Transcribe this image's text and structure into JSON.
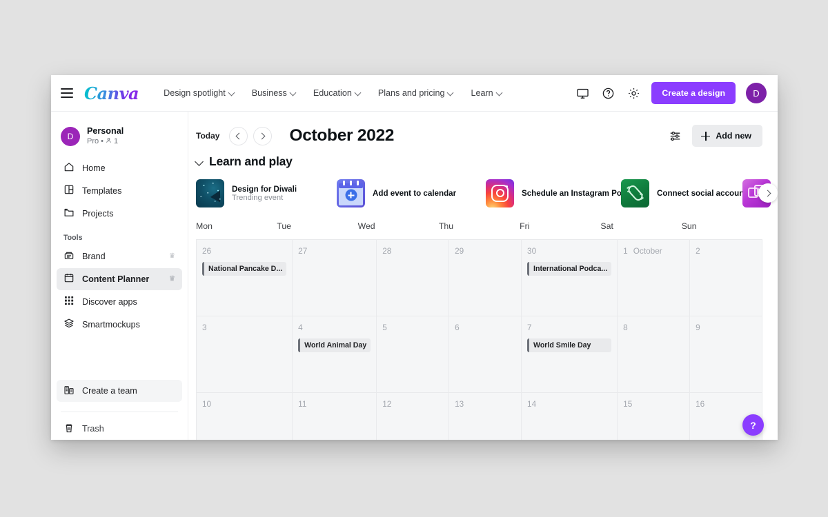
{
  "header": {
    "menu_icon": "hamburger-icon",
    "logo_text": "Canva",
    "nav": [
      {
        "label": "Design spotlight"
      },
      {
        "label": "Business"
      },
      {
        "label": "Education"
      },
      {
        "label": "Plans and pricing"
      },
      {
        "label": "Learn"
      }
    ],
    "icons": [
      {
        "name": "monitor-icon"
      },
      {
        "name": "help-circle-icon"
      },
      {
        "name": "gear-icon"
      }
    ],
    "cta_label": "Create a design",
    "avatar_initial": "D"
  },
  "sidebar": {
    "account": {
      "avatar_initial": "D",
      "name": "Personal",
      "plan": "Pro",
      "separator": "•",
      "members": "1"
    },
    "items": [
      {
        "label": "Home",
        "icon": "home-icon",
        "pro": false,
        "active": false
      },
      {
        "label": "Templates",
        "icon": "templates-icon",
        "pro": false,
        "active": false
      },
      {
        "label": "Projects",
        "icon": "folder-icon",
        "pro": false,
        "active": false
      }
    ],
    "tools_label": "Tools",
    "tools": [
      {
        "label": "Brand",
        "icon": "brand-icon",
        "pro": true,
        "active": false
      },
      {
        "label": "Content Planner",
        "icon": "calendar-icon",
        "pro": true,
        "active": true
      },
      {
        "label": "Discover apps",
        "icon": "apps-grid-icon",
        "pro": false,
        "active": false
      },
      {
        "label": "Smartmockups",
        "icon": "stack-icon",
        "pro": false,
        "active": false
      }
    ],
    "bottom": [
      {
        "label": "Create a team",
        "icon": "team-icon",
        "highlight": true
      },
      {
        "label": "Trash",
        "icon": "trash-icon",
        "highlight": false
      }
    ],
    "crown_glyph": "♛"
  },
  "toolbar": {
    "today_label": "Today",
    "prev_icon": "chevron-left-icon",
    "next_icon": "chevron-right-icon",
    "month_title": "October 2022",
    "filter_icon": "sliders-icon",
    "add_new_label": "Add new"
  },
  "section": {
    "collapse_icon": "chevron-down-icon",
    "title": "Learn and play",
    "cards": [
      {
        "title": "Design for Diwali",
        "subtitle": "Trending event",
        "thumb": "diwali-sparkler-thumb"
      },
      {
        "title": "Add event to calendar",
        "subtitle": "",
        "thumb": "calendar-plus-thumb"
      },
      {
        "title": "Schedule an Instagram Post",
        "subtitle": "",
        "thumb": "instagram-thumb"
      },
      {
        "title": "Connect social accounts",
        "subtitle": "",
        "thumb": "link-thumb"
      },
      {
        "title": "",
        "subtitle": "",
        "thumb": "video-thumb"
      }
    ],
    "next_icon": "chevron-right-icon"
  },
  "calendar": {
    "weekdays": [
      "Mon",
      "Tue",
      "Wed",
      "Thu",
      "Fri",
      "Sat",
      "Sun"
    ],
    "cells": [
      {
        "day": "26",
        "month_label": "",
        "events": [
          {
            "title": "National Pancake D..."
          }
        ]
      },
      {
        "day": "27",
        "month_label": "",
        "events": []
      },
      {
        "day": "28",
        "month_label": "",
        "events": []
      },
      {
        "day": "29",
        "month_label": "",
        "events": []
      },
      {
        "day": "30",
        "month_label": "",
        "events": [
          {
            "title": "International Podca..."
          }
        ]
      },
      {
        "day": "1",
        "month_label": "October",
        "events": []
      },
      {
        "day": "2",
        "month_label": "",
        "events": []
      },
      {
        "day": "3",
        "month_label": "",
        "events": []
      },
      {
        "day": "4",
        "month_label": "",
        "events": [
          {
            "title": "World Animal Day"
          }
        ]
      },
      {
        "day": "5",
        "month_label": "",
        "events": []
      },
      {
        "day": "6",
        "month_label": "",
        "events": []
      },
      {
        "day": "7",
        "month_label": "",
        "events": [
          {
            "title": "World Smile Day"
          }
        ]
      },
      {
        "day": "8",
        "month_label": "",
        "events": []
      },
      {
        "day": "9",
        "month_label": "",
        "events": []
      },
      {
        "day": "10",
        "month_label": "",
        "events": []
      },
      {
        "day": "11",
        "month_label": "",
        "events": []
      },
      {
        "day": "12",
        "month_label": "",
        "events": []
      },
      {
        "day": "13",
        "month_label": "",
        "events": []
      },
      {
        "day": "14",
        "month_label": "",
        "events": []
      },
      {
        "day": "15",
        "month_label": "",
        "events": []
      },
      {
        "day": "16",
        "month_label": "",
        "events": []
      }
    ]
  },
  "help_fab": {
    "label": "?"
  },
  "colors": {
    "accent": "#8b3dff",
    "avatar": "#7d21a8",
    "sidebar_active": "#ebecee",
    "grid_bg": "#f5f6f7",
    "grid_line": "#e9eaec",
    "page_bg": "#e2e2e2"
  }
}
